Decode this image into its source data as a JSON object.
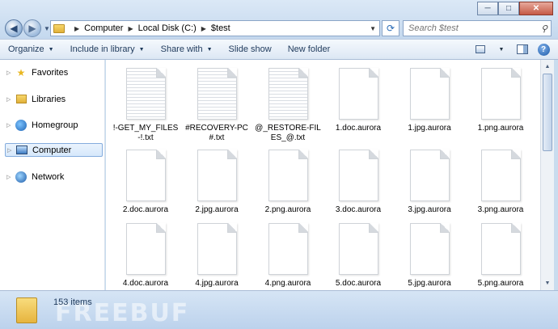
{
  "window": {
    "min_label": "─",
    "max_label": "□",
    "close_label": "✕"
  },
  "nav": {
    "back_icon": "back-arrow-icon",
    "forward_icon": "forward-arrow-icon"
  },
  "address": {
    "crumbs": [
      "Computer",
      "Local Disk (C:)",
      "$test"
    ]
  },
  "search": {
    "placeholder": "Search $test"
  },
  "toolbar": {
    "organize": "Organize",
    "include_in_library": "Include in library",
    "share_with": "Share with",
    "slide_show": "Slide show",
    "new_folder": "New folder"
  },
  "sidebar": {
    "items": [
      {
        "label": "Favorites",
        "icon": "star-icon"
      },
      {
        "label": "Libraries",
        "icon": "libraries-icon"
      },
      {
        "label": "Homegroup",
        "icon": "homegroup-icon"
      },
      {
        "label": "Computer",
        "icon": "computer-icon",
        "selected": true
      },
      {
        "label": "Network",
        "icon": "network-icon"
      }
    ]
  },
  "files": [
    {
      "name": "!-GET_MY_FILES-!.txt",
      "kind": "txt"
    },
    {
      "name": "#RECOVERY-PC#.txt",
      "kind": "txt"
    },
    {
      "name": "@_RESTORE-FILES_@.txt",
      "kind": "txt"
    },
    {
      "name": "1.doc.aurora",
      "kind": "blank"
    },
    {
      "name": "1.jpg.aurora",
      "kind": "blank"
    },
    {
      "name": "1.png.aurora",
      "kind": "blank"
    },
    {
      "name": "2.doc.aurora",
      "kind": "blank"
    },
    {
      "name": "2.jpg.aurora",
      "kind": "blank"
    },
    {
      "name": "2.png.aurora",
      "kind": "blank"
    },
    {
      "name": "3.doc.aurora",
      "kind": "blank"
    },
    {
      "name": "3.jpg.aurora",
      "kind": "blank"
    },
    {
      "name": "3.png.aurora",
      "kind": "blank"
    },
    {
      "name": "4.doc.aurora",
      "kind": "blank"
    },
    {
      "name": "4.jpg.aurora",
      "kind": "blank"
    },
    {
      "name": "4.png.aurora",
      "kind": "blank"
    },
    {
      "name": "5.doc.aurora",
      "kind": "blank"
    },
    {
      "name": "5.jpg.aurora",
      "kind": "blank"
    },
    {
      "name": "5.png.aurora",
      "kind": "blank"
    }
  ],
  "status": {
    "count": "153 items",
    "watermark": "FREEBUF"
  }
}
